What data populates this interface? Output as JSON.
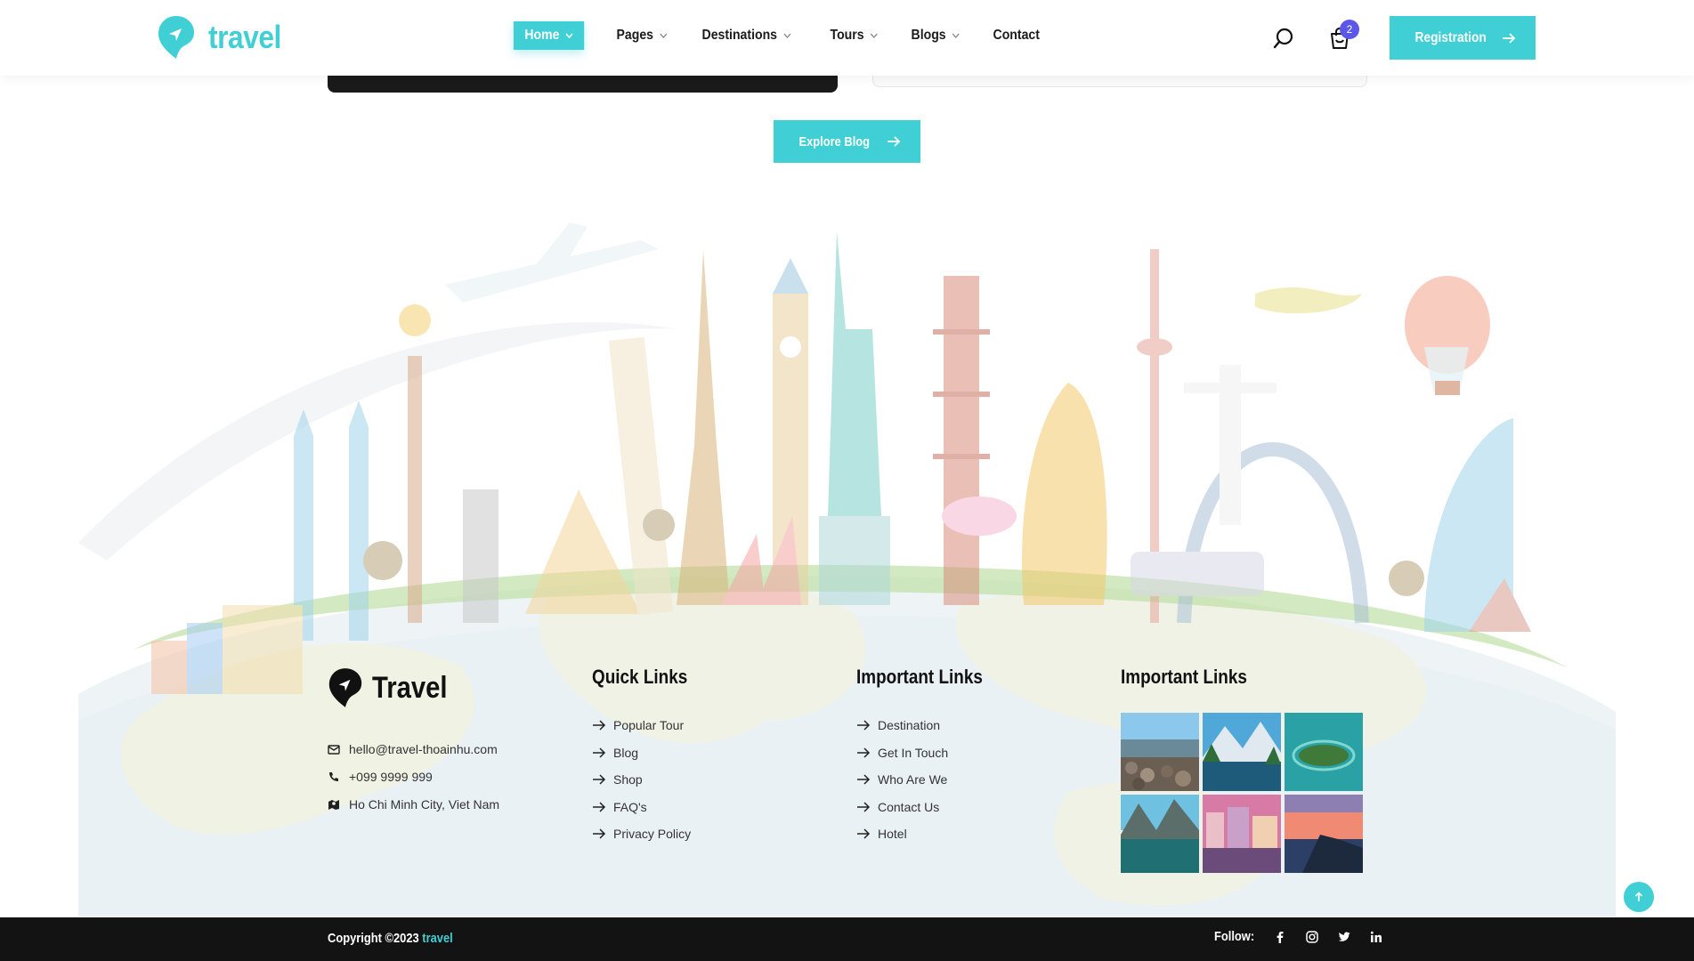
{
  "header": {
    "logo_text": "travel",
    "nav": [
      {
        "label": "Home",
        "has_dropdown": true,
        "active": true
      },
      {
        "label": "Pages",
        "has_dropdown": true
      },
      {
        "label": "Destinations",
        "has_dropdown": true
      },
      {
        "label": "Tours",
        "has_dropdown": true
      },
      {
        "label": "Blogs",
        "has_dropdown": true
      },
      {
        "label": "Contact",
        "has_dropdown": false
      }
    ],
    "cart_count": "2",
    "registration_label": "Registration"
  },
  "explore_label": "Explore Blog",
  "footer": {
    "brand": "Travel",
    "contact": {
      "email": "hello@travel-thoainhu.com",
      "phone": "+099 9999 999",
      "address": "Ho Chi Minh City, Viet Nam"
    },
    "quick_links": {
      "title": "Quick Links",
      "items": [
        "Popular Tour",
        "Blog",
        "Shop",
        "FAQ's",
        "Privacy Policy"
      ]
    },
    "important_links": {
      "title": "Important Links",
      "items": [
        "Destination",
        "Get In Touch",
        "Who Are We",
        "Contact Us",
        "Hotel"
      ]
    },
    "gallery": {
      "title": "Important Links"
    }
  },
  "bottom": {
    "copyright_prefix": "Copyright ©2023",
    "copyright_brand": "travel",
    "follow_label": "Follow:"
  },
  "colors": {
    "accent": "#3fcfd4",
    "badge": "#5b57e8",
    "bottom_bar": "#131313"
  }
}
